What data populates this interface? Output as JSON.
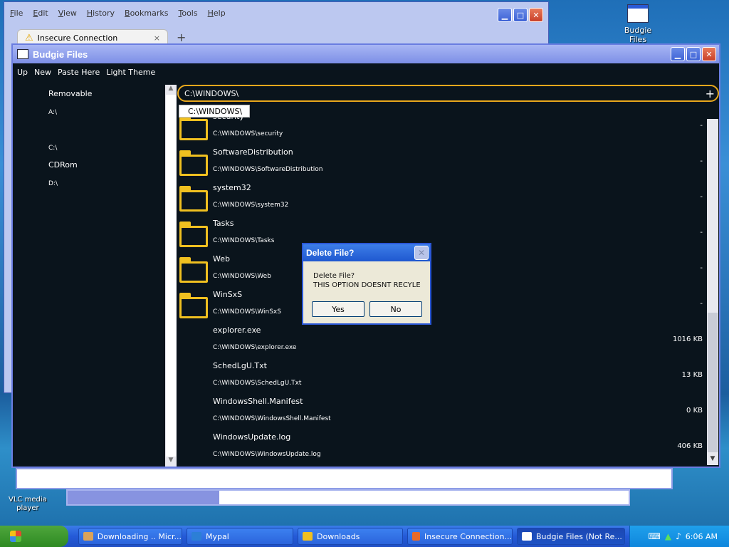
{
  "desktop": {
    "icon_budgie": "Budgie Files",
    "icon_vlc_line1": "VLC media",
    "icon_vlc_line2": "player"
  },
  "browser": {
    "menu": [
      "File",
      "Edit",
      "View",
      "History",
      "Bookmarks",
      "Tools",
      "Help"
    ],
    "tab_title": "Insecure Connection",
    "tab_close": "×",
    "new_tab": "+"
  },
  "budgie": {
    "title": "Budgie Files",
    "toolbar": [
      "Up",
      "New",
      "Paste Here",
      "Light Theme"
    ],
    "sidebar": {
      "removable_label": "Removable",
      "removable_drive": "A:\\",
      "fixed_drive": "C:\\",
      "cdrom_label": "CDRom",
      "cdrom_drive": "D:\\"
    },
    "path": "C:\\WINDOWS\\",
    "path_plus": "+",
    "suggestion": "C:\\WINDOWS\\",
    "files": [
      {
        "name": "security",
        "path": "C:\\WINDOWS\\security",
        "size": "-",
        "folder": true
      },
      {
        "name": "SoftwareDistribution",
        "path": "C:\\WINDOWS\\SoftwareDistribution",
        "size": "-",
        "folder": true
      },
      {
        "name": "system32",
        "path": "C:\\WINDOWS\\system32",
        "size": "-",
        "folder": true
      },
      {
        "name": "Tasks",
        "path": "C:\\WINDOWS\\Tasks",
        "size": "-",
        "folder": true
      },
      {
        "name": "Web",
        "path": "C:\\WINDOWS\\Web",
        "size": "-",
        "folder": true
      },
      {
        "name": "WinSxS",
        "path": "C:\\WINDOWS\\WinSxS",
        "size": "-",
        "folder": true
      },
      {
        "name": "explorer.exe",
        "path": "C:\\WINDOWS\\explorer.exe",
        "size": "1016 KB",
        "folder": false
      },
      {
        "name": "SchedLgU.Txt",
        "path": "C:\\WINDOWS\\SchedLgU.Txt",
        "size": "13 KB",
        "folder": false
      },
      {
        "name": "WindowsShell.Manifest",
        "path": "C:\\WINDOWS\\WindowsShell.Manifest",
        "size": "0 KB",
        "folder": false
      },
      {
        "name": "WindowsUpdate.log",
        "path": "C:\\WINDOWS\\WindowsUpdate.log",
        "size": "406 KB",
        "folder": false
      }
    ]
  },
  "dialog": {
    "title": "Delete File?",
    "line1": "Delete File?",
    "line2": "THIS OPTION DOESNT RECYLE",
    "yes": "Yes",
    "no": "No"
  },
  "progress": {
    "fraction": 0.27
  },
  "taskbar": {
    "items": [
      {
        "label": "Downloading .. Micr...",
        "icon_color": "#d9a35a"
      },
      {
        "label": "Mypal",
        "icon_color": "#2c7fd6"
      },
      {
        "label": "Downloads",
        "icon_color": "#f0c020"
      },
      {
        "label": "Insecure Connection...",
        "icon_color": "#e86a2a"
      },
      {
        "label": "Budgie Files (Not Re...",
        "icon_color": "#ffffff"
      }
    ],
    "clock": "6:06 AM"
  },
  "icons": [
    "warning-icon",
    "folder-icon",
    "plus-icon",
    "close-icon",
    "minimize-icon",
    "maximize-icon",
    "windows-flag-icon",
    "keyboard-icon",
    "network-icon",
    "speaker-icon"
  ]
}
